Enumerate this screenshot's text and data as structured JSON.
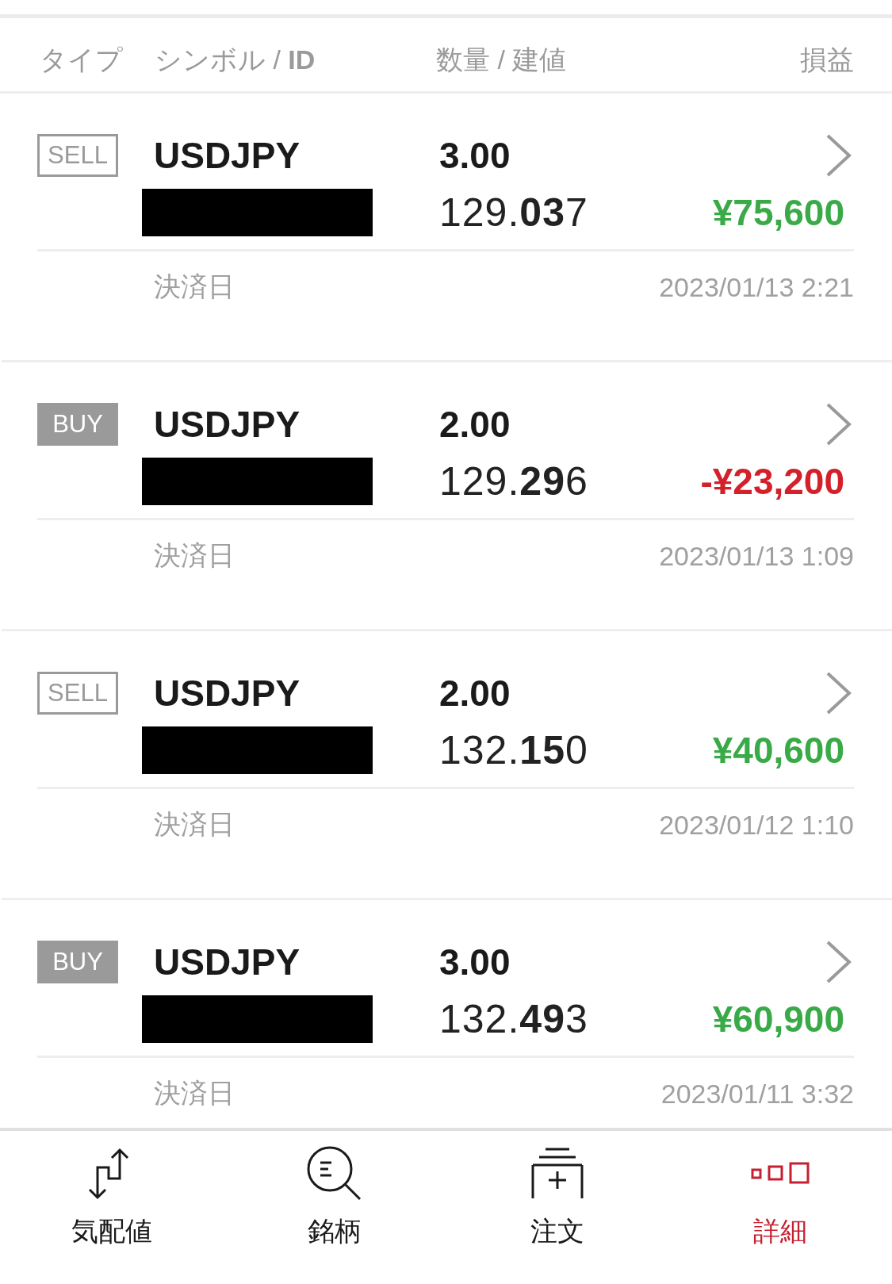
{
  "header": {
    "columns": [
      "タイプ",
      "シンボル / **ID**",
      "数量 / 建値",
      "損益"
    ]
  },
  "trades": [
    {
      "kind": "sell",
      "side": "SELL",
      "symbol": "USDJPY",
      "quantity": "3.00",
      "price": "129.**03**7",
      "profit": "¥75,600",
      "color": "#3aaa48",
      "date_label": "決済日",
      "date": "2023/01/13 2:21"
    },
    {
      "kind": "buy",
      "side": "BUY",
      "symbol": "USDJPY",
      "quantity": "2.00",
      "price": "129.**29**6",
      "profit": "-¥23,200",
      "color": "#d3202b",
      "date_label": "決済日",
      "date": "2023/01/13 1:09"
    },
    {
      "kind": "sell",
      "side": "SELL",
      "symbol": "USDJPY",
      "quantity": "2.00",
      "price": "132.**15**0",
      "profit": "¥40,600",
      "color": "#3aaa48",
      "date_label": "決済日",
      "date": "2023/01/12 1:10"
    },
    {
      "kind": "buy",
      "side": "BUY",
      "symbol": "USDJPY",
      "quantity": "3.00",
      "price": "132.**49**3",
      "profit": "¥60,900",
      "color": "#3aaa48",
      "date_label": "決済日",
      "date": "2023/01/11 3:32"
    }
  ],
  "nav": [
    {
      "label": "気配値",
      "selected": false
    },
    {
      "label": "銘柄",
      "selected": false
    },
    {
      "label": "注文",
      "selected": false
    },
    {
      "label": "詳細",
      "selected": true
    }
  ]
}
